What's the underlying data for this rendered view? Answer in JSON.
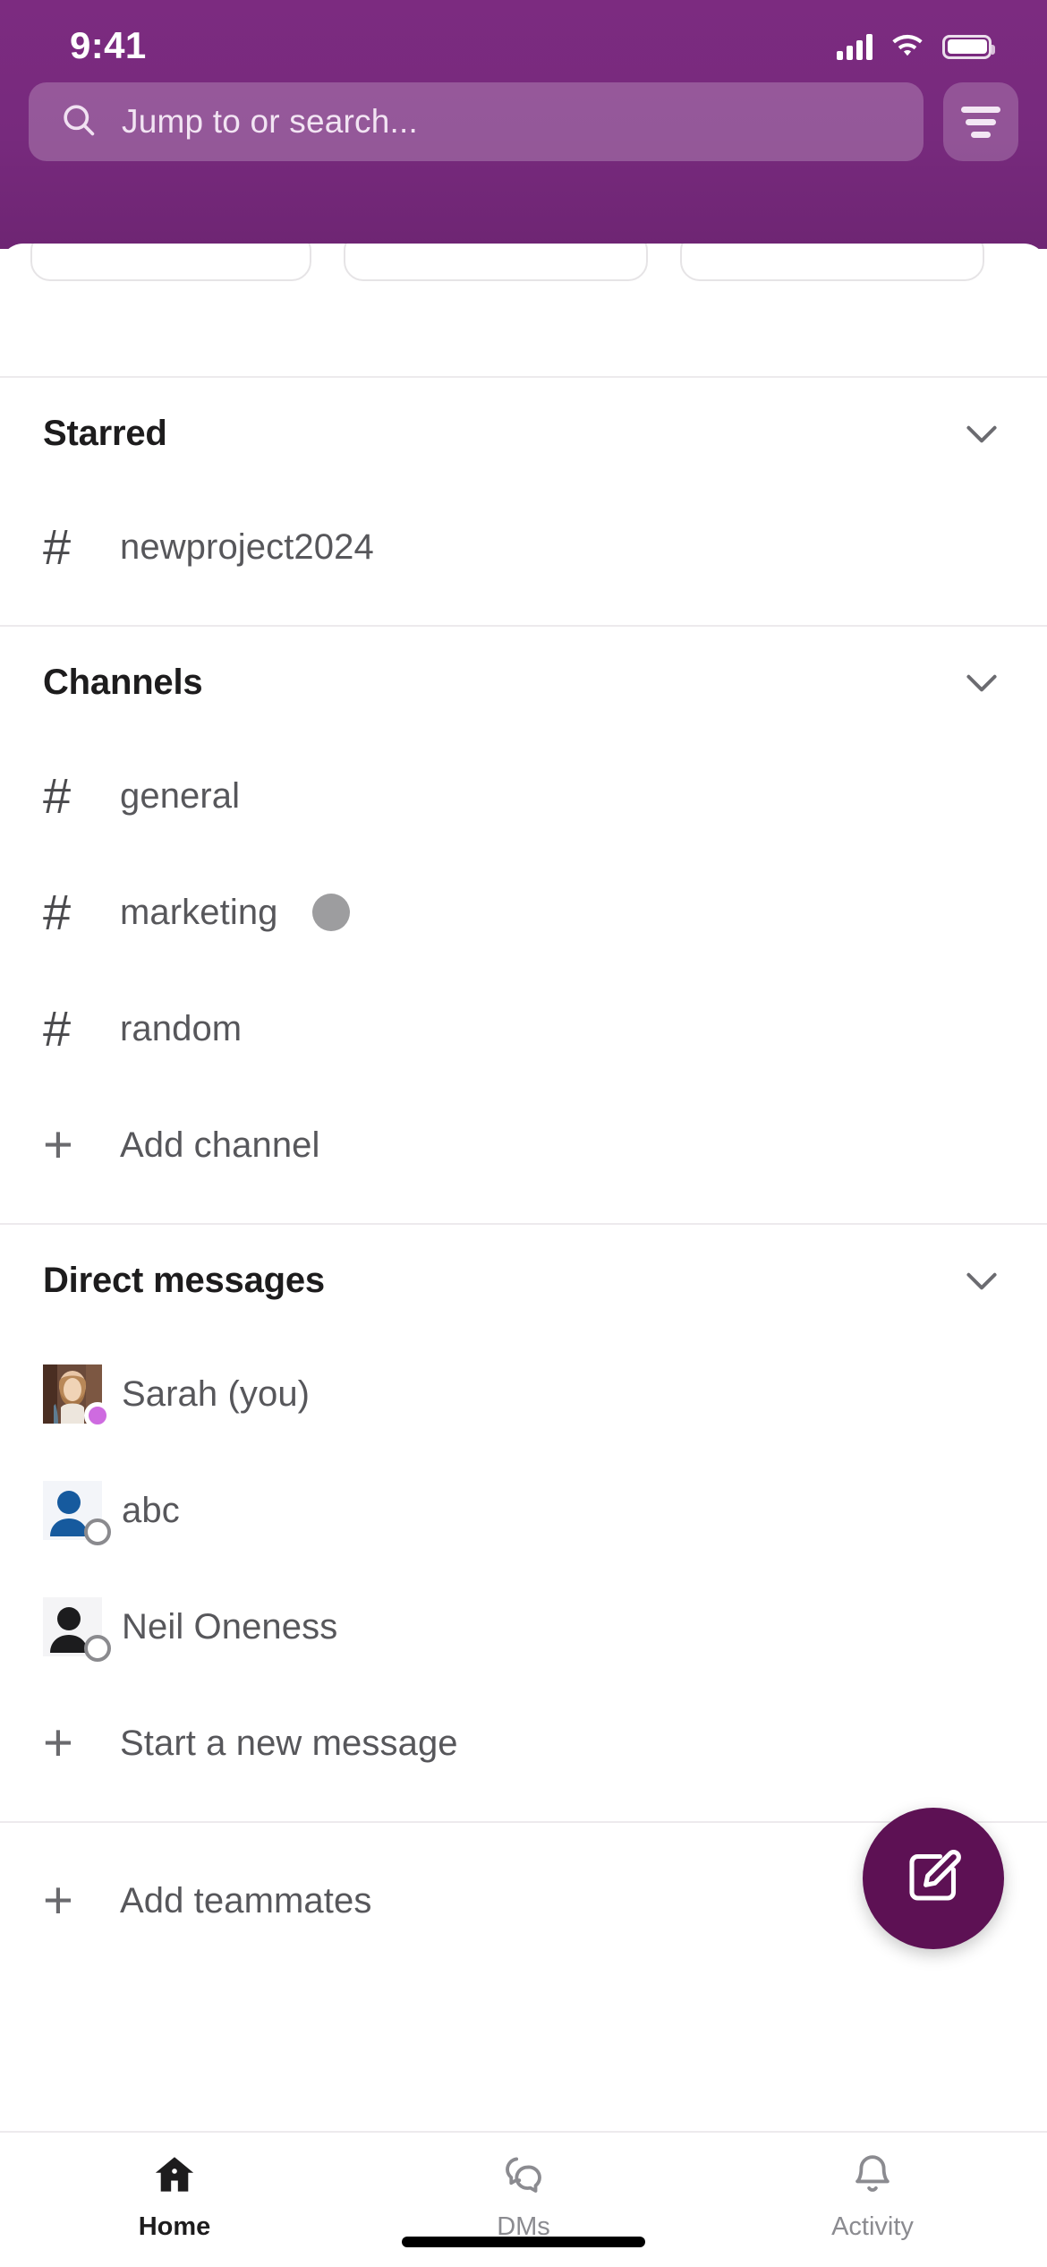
{
  "status_bar": {
    "time": "9:41",
    "signal_icon": "cellular-signal-icon",
    "wifi_icon": "wifi-icon",
    "battery_icon": "battery-icon"
  },
  "header": {
    "accent_color": "#7C2B80",
    "search": {
      "placeholder": "Jump to or search...",
      "value": "",
      "icon": "search-icon"
    },
    "filter_button": {
      "icon": "filter-icon",
      "label": "Filter"
    }
  },
  "chips": [
    {
      "label": ""
    },
    {
      "label": ""
    },
    {
      "label": ""
    }
  ],
  "sections": [
    {
      "id": "starred",
      "title": "Starred",
      "collapse_icon": "chevron-down-icon",
      "rows": [
        {
          "type": "channel",
          "icon": "hash-icon",
          "glyph": "#",
          "label": "newproject2024",
          "unread": false
        }
      ]
    },
    {
      "id": "channels",
      "title": "Channels",
      "collapse_icon": "chevron-down-icon",
      "rows": [
        {
          "type": "channel",
          "icon": "hash-icon",
          "glyph": "#",
          "label": "general",
          "unread": false
        },
        {
          "type": "channel",
          "icon": "hash-icon",
          "glyph": "#",
          "label": "marketing",
          "unread": true
        },
        {
          "type": "channel",
          "icon": "hash-icon",
          "glyph": "#",
          "label": "random",
          "unread": false
        },
        {
          "type": "action",
          "icon": "plus-icon",
          "glyph": "+",
          "label": "Add channel",
          "unread": false
        }
      ]
    },
    {
      "id": "direct-messages",
      "title": "Direct messages",
      "collapse_icon": "chevron-down-icon",
      "rows": [
        {
          "type": "dm",
          "avatar": "photo-avatar",
          "label": "Sarah (you)",
          "presence": "active"
        },
        {
          "type": "dm",
          "avatar": "person-avatar-blue",
          "label": "abc",
          "presence": "away"
        },
        {
          "type": "dm",
          "avatar": "person-avatar-dark",
          "label": "Neil Oneness",
          "presence": "away"
        },
        {
          "type": "action",
          "icon": "plus-icon",
          "glyph": "+",
          "label": "Start a new message"
        }
      ]
    },
    {
      "id": "teammates",
      "title": "",
      "rows": [
        {
          "type": "action",
          "icon": "plus-icon",
          "glyph": "+",
          "label": "Add teammates"
        }
      ]
    }
  ],
  "compose_button": {
    "icon": "compose-pencil-icon",
    "label": "New message",
    "color": "#5D1154"
  },
  "tab_bar": {
    "active": "Home",
    "tabs": [
      {
        "label": "Home",
        "icon": "home-icon",
        "active": true
      },
      {
        "label": "DMs",
        "icon": "dms-icon",
        "active": false
      },
      {
        "label": "Activity",
        "icon": "bell-icon",
        "active": false
      }
    ]
  }
}
